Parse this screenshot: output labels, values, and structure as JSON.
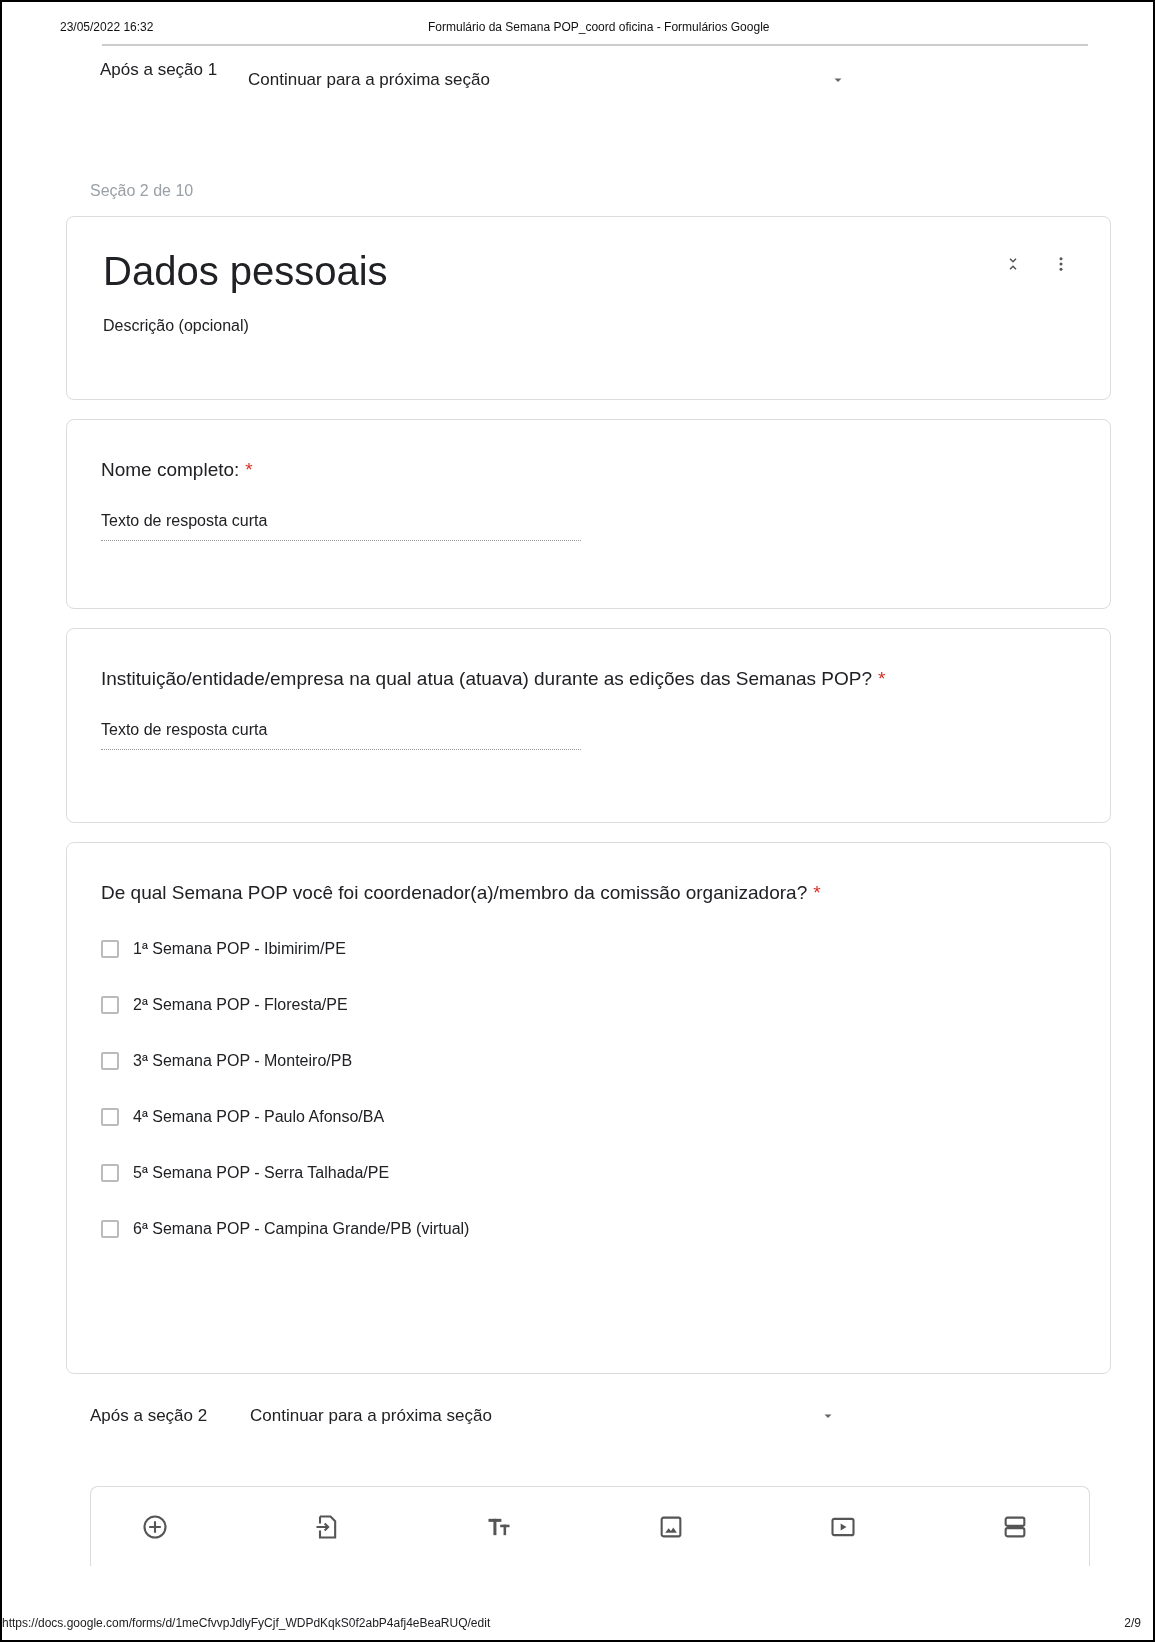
{
  "print_header": {
    "date": "23/05/2022 16:32",
    "title": "Formulário da Semana POP_coord oficina - Formulários Google"
  },
  "after_section_top": {
    "label": "Após a seção 1",
    "value": "Continuar para a próxima seção"
  },
  "section_counter": "Seção 2 de 10",
  "section_card": {
    "title": "Dados pessoais",
    "description": "Descrição (opcional)"
  },
  "questions": [
    {
      "kind": "short",
      "title": "Nome completo:",
      "required_mark": "*",
      "placeholder": "Texto de resposta curta"
    },
    {
      "kind": "short",
      "title": "Instituição/entidade/empresa na qual atua (atuava) durante as edições das Semanas POP?",
      "required_mark": "*",
      "placeholder": "Texto de resposta curta"
    },
    {
      "kind": "checkbox",
      "title": "De qual Semana POP você foi coordenador(a)/membro da comissão organizadora?",
      "required_mark": "*",
      "options": [
        {
          "label": "1ª Semana POP - Ibimirim/PE",
          "checked": false
        },
        {
          "label": "2ª Semana POP - Floresta/PE",
          "checked": false
        },
        {
          "label": "3ª Semana POP - Monteiro/PB",
          "checked": false
        },
        {
          "label": "4ª Semana POP - Paulo Afonso/BA",
          "checked": false
        },
        {
          "label": "5ª Semana POP - Serra Talhada/PE",
          "checked": false
        },
        {
          "label": "6ª Semana POP - Campina Grande/PB (virtual)",
          "checked": false
        }
      ]
    }
  ],
  "after_section_bottom": {
    "label": "Após a seção 2",
    "value": "Continuar para a próxima seção"
  },
  "toolbar": [
    {
      "kind": "add"
    },
    {
      "kind": "import"
    },
    {
      "kind": "title"
    },
    {
      "kind": "image"
    },
    {
      "kind": "video"
    },
    {
      "kind": "section"
    }
  ],
  "print_footer": {
    "url": "https://docs.google.com/forms/d/1meCfvvpJdlyFyCjf_WDPdKqkS0f2abP4afj4eBeaRUQ/edit",
    "page": "2/9"
  }
}
